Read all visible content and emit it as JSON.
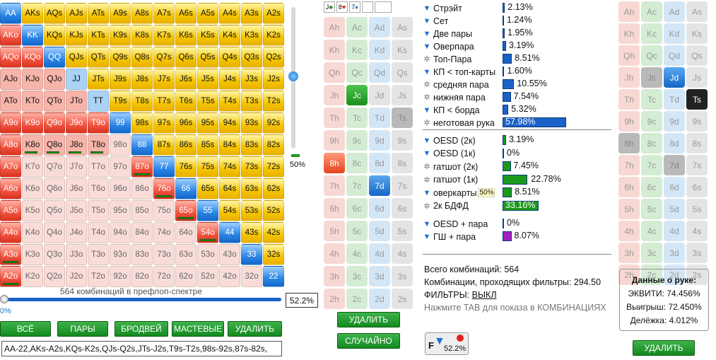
{
  "matrix": {
    "cells": [
      [
        "AA",
        "AKs",
        "AQs",
        "AJs",
        "ATs",
        "A9s",
        "A8s",
        "A7s",
        "A6s",
        "A5s",
        "A4s",
        "A3s",
        "A2s"
      ],
      [
        "AKo",
        "KK",
        "KQs",
        "KJs",
        "KTs",
        "K9s",
        "K8s",
        "K7s",
        "K6s",
        "K5s",
        "K4s",
        "K3s",
        "K2s"
      ],
      [
        "AQo",
        "KQo",
        "QQ",
        "QJs",
        "QTs",
        "Q9s",
        "Q8s",
        "Q7s",
        "Q6s",
        "Q5s",
        "Q4s",
        "Q3s",
        "Q2s"
      ],
      [
        "AJo",
        "KJo",
        "QJo",
        "JJ",
        "JTs",
        "J9s",
        "J8s",
        "J7s",
        "J6s",
        "J5s",
        "J4s",
        "J3s",
        "J2s"
      ],
      [
        "ATo",
        "KTo",
        "QTo",
        "JTo",
        "TT",
        "T9s",
        "T8s",
        "T7s",
        "T6s",
        "T5s",
        "T4s",
        "T3s",
        "T2s"
      ],
      [
        "A9o",
        "K9o",
        "Q9o",
        "J9o",
        "T9o",
        "99",
        "98s",
        "97s",
        "96s",
        "95s",
        "94s",
        "93s",
        "92s"
      ],
      [
        "A8o",
        "K8o",
        "Q8o",
        "J8o",
        "T8o",
        "98o",
        "88",
        "87s",
        "86s",
        "85s",
        "84s",
        "83s",
        "82s"
      ],
      [
        "A7o",
        "K7o",
        "Q7o",
        "J7o",
        "T7o",
        "97o",
        "87o",
        "77",
        "76s",
        "75s",
        "74s",
        "73s",
        "72s"
      ],
      [
        "A6o",
        "K6o",
        "Q6o",
        "J6o",
        "T6o",
        "96o",
        "86o",
        "76o",
        "66",
        "65s",
        "64s",
        "63s",
        "62s"
      ],
      [
        "A5o",
        "K5o",
        "Q5o",
        "J5o",
        "T5o",
        "95o",
        "85o",
        "75o",
        "65o",
        "55",
        "54s",
        "53s",
        "52s"
      ],
      [
        "A4o",
        "K4o",
        "Q4o",
        "J4o",
        "T4o",
        "94o",
        "84o",
        "74o",
        "64o",
        "54o",
        "44",
        "43s",
        "42s"
      ],
      [
        "A3o",
        "K3o",
        "Q3o",
        "J3o",
        "T3o",
        "93o",
        "83o",
        "73o",
        "63o",
        "53o",
        "43o",
        "33",
        "32s"
      ],
      [
        "A2o",
        "K2o",
        "Q2o",
        "J2o",
        "T2o",
        "92o",
        "82o",
        "72o",
        "62o",
        "52o",
        "42o",
        "32o",
        "22"
      ]
    ],
    "combo_label": "564 комбинаций в префлоп-спектре",
    "vertical_pct": "50%",
    "horizontal_pct": "52.2%",
    "horizontal_zero": "0%",
    "vertical_slider_level": 0.5,
    "horizontal_slider_level": 0.0
  },
  "matrix_buttons": [
    "ВСЁ",
    "ПАРЫ",
    "БРОДВЕЙ",
    "МАСТЕВЫЕ",
    "УДАЛИТЬ"
  ],
  "range_text": "AA-22,AKs-A2s,KQs-K2s,QJs-Q2s,JTs-J2s,T9s-T2s,98s-92s,87s-82s,",
  "board": {
    "slots": [
      {
        "rank": "J",
        "suit": "♣",
        "color": "#1a8f1a"
      },
      {
        "rank": "8",
        "suit": "♥",
        "color": "#d82020"
      },
      {
        "rank": "7",
        "suit": "♦",
        "color": "#1a76d2"
      },
      {
        "rank": "",
        "suit": "",
        "color": "#000"
      },
      {
        "rank": "",
        "suit": "",
        "color": "#000"
      }
    ],
    "rows": [
      [
        {
          "t": "Ah",
          "s": "h"
        },
        {
          "t": "Ac",
          "s": "c"
        },
        {
          "t": "Ad",
          "s": "d"
        },
        {
          "t": "As",
          "s": "s"
        }
      ],
      [
        {
          "t": "Kh",
          "s": "h"
        },
        {
          "t": "Kc",
          "s": "c"
        },
        {
          "t": "Kd",
          "s": "d"
        },
        {
          "t": "Ks",
          "s": "s"
        }
      ],
      [
        {
          "t": "Qh",
          "s": "h"
        },
        {
          "t": "Qc",
          "s": "c"
        },
        {
          "t": "Qd",
          "s": "d"
        },
        {
          "t": "Qs",
          "s": "s"
        }
      ],
      [
        {
          "t": "Jh",
          "s": "h"
        },
        {
          "t": "Jc",
          "s": "on-c"
        },
        {
          "t": "Jd",
          "s": "s"
        },
        {
          "t": "Js",
          "s": "s"
        }
      ],
      [
        {
          "t": "Th",
          "s": "h"
        },
        {
          "t": "Tc",
          "s": "c"
        },
        {
          "t": "Td",
          "s": "d"
        },
        {
          "t": "Ts",
          "s": "dis"
        }
      ],
      [
        {
          "t": "9h",
          "s": "h"
        },
        {
          "t": "9c",
          "s": "c"
        },
        {
          "t": "9d",
          "s": "d"
        },
        {
          "t": "9s",
          "s": "s"
        }
      ],
      [
        {
          "t": "8h",
          "s": "on-h"
        },
        {
          "t": "8c",
          "s": "c"
        },
        {
          "t": "8d",
          "s": "d"
        },
        {
          "t": "8s",
          "s": "s"
        }
      ],
      [
        {
          "t": "7h",
          "s": "h"
        },
        {
          "t": "7c",
          "s": "c"
        },
        {
          "t": "7d",
          "s": "on-d"
        },
        {
          "t": "7s",
          "s": "s"
        }
      ],
      [
        {
          "t": "6h",
          "s": "h"
        },
        {
          "t": "6c",
          "s": "c"
        },
        {
          "t": "6d",
          "s": "d"
        },
        {
          "t": "6s",
          "s": "s"
        }
      ],
      [
        {
          "t": "5h",
          "s": "h"
        },
        {
          "t": "5c",
          "s": "c"
        },
        {
          "t": "5d",
          "s": "d"
        },
        {
          "t": "5s",
          "s": "s"
        }
      ],
      [
        {
          "t": "4h",
          "s": "h"
        },
        {
          "t": "4c",
          "s": "c"
        },
        {
          "t": "4d",
          "s": "d"
        },
        {
          "t": "4s",
          "s": "s"
        }
      ],
      [
        {
          "t": "3h",
          "s": "h"
        },
        {
          "t": "3c",
          "s": "c"
        },
        {
          "t": "3d",
          "s": "d"
        },
        {
          "t": "3s",
          "s": "s"
        }
      ],
      [
        {
          "t": "2h",
          "s": "h"
        },
        {
          "t": "2c",
          "s": "c"
        },
        {
          "t": "2d",
          "s": "d"
        },
        {
          "t": "2s",
          "s": "s"
        }
      ]
    ],
    "delete": "УДАЛИТЬ",
    "random": "СЛУЧАЙНО"
  },
  "stats": [
    {
      "icon": "filter",
      "label": "Стрэйт",
      "pct": "2.13%",
      "value": 2.13,
      "color": "#1a62c8"
    },
    {
      "icon": "filter",
      "label": "Сет",
      "pct": "1.24%",
      "value": 1.24,
      "color": "#1a62c8"
    },
    {
      "icon": "filter",
      "label": "Две пары",
      "pct": "1.95%",
      "value": 1.95,
      "color": "#1a62c8"
    },
    {
      "icon": "filter",
      "label": "Оверпара",
      "pct": "3.19%",
      "value": 3.19,
      "color": "#1a62c8"
    },
    {
      "icon": "gear",
      "label": "Топ-Пара",
      "pct": "8.51%",
      "value": 8.51,
      "color": "#1a62c8"
    },
    {
      "icon": "filter",
      "label": "КП < топ-карты",
      "pct": "1.60%",
      "value": 1.6,
      "color": "#1a62c8"
    },
    {
      "icon": "gear",
      "label": "средняя пара",
      "pct": "10.55%",
      "value": 10.55,
      "color": "#1a62c8"
    },
    {
      "icon": "gear",
      "label": "нижняя пара",
      "pct": "7.54%",
      "value": 7.54,
      "color": "#1a62c8"
    },
    {
      "icon": "filter",
      "label": "КП < борда",
      "pct": "5.32%",
      "value": 5.32,
      "color": "#1a62c8"
    },
    {
      "icon": "gear",
      "label": "неготовая рука",
      "pct": "57.98%",
      "value": 57.98,
      "color": "#1a62c8"
    }
  ],
  "draws": [
    {
      "icon": "filter",
      "label": "OESD (2к)",
      "pct": "3.19%",
      "value": 3.19,
      "color": "#1a9a1a"
    },
    {
      "icon": "filter",
      "label": "OESD (1к)",
      "pct": "0%",
      "value": 0,
      "color": "#1a9a1a"
    },
    {
      "icon": "gear",
      "label": "гатшот (2к)",
      "pct": "7.45%",
      "value": 7.45,
      "color": "#1a9a1a"
    },
    {
      "icon": "gear",
      "label": "гатшот (1к)",
      "pct": "22.78%",
      "value": 22.78,
      "color": "#1a9a1a"
    },
    {
      "icon": "filter",
      "label": "оверкарты",
      "badge": "50%",
      "pct": "8.51%",
      "value": 8.51,
      "color": "#1a9a1a"
    },
    {
      "icon": "gear",
      "label": "2к БДФД",
      "pct": "33.16%",
      "value": 33.16,
      "color": "#1a9a1a"
    }
  ],
  "combos": [
    {
      "icon": "filter",
      "label": "OESD + пара",
      "pct": "0%",
      "value": 0,
      "color": "#a020c0"
    },
    {
      "icon": "filter",
      "label": "ГШ + пара",
      "pct": "8.07%",
      "value": 8.07,
      "color": "#a020c0"
    }
  ],
  "summary": {
    "total": "Всего комбинаций: 564",
    "passing": "Комбинации, проходящих фильтры: 294.50",
    "filters_label": "ФИЛЬТРЫ:",
    "filters_value": "ВЫКЛ",
    "hint": "Нажмите TAB для показа в КОМБИНАЦИЯХ",
    "f_badge": "52.2%"
  },
  "hand": {
    "rows": [
      [
        {
          "t": "Ah",
          "s": "h"
        },
        {
          "t": "Ac",
          "s": "c"
        },
        {
          "t": "Ad",
          "s": "d"
        },
        {
          "t": "As",
          "s": "s"
        }
      ],
      [
        {
          "t": "Kh",
          "s": "h"
        },
        {
          "t": "Kc",
          "s": "c"
        },
        {
          "t": "Kd",
          "s": "d"
        },
        {
          "t": "Ks",
          "s": "s"
        }
      ],
      [
        {
          "t": "Qh",
          "s": "h"
        },
        {
          "t": "Qc",
          "s": "c"
        },
        {
          "t": "Qd",
          "s": "d"
        },
        {
          "t": "Qs",
          "s": "s"
        }
      ],
      [
        {
          "t": "Jh",
          "s": "h"
        },
        {
          "t": "Jc",
          "s": "dis"
        },
        {
          "t": "Jd",
          "s": "on-d"
        },
        {
          "t": "Js",
          "s": "s"
        }
      ],
      [
        {
          "t": "Th",
          "s": "h"
        },
        {
          "t": "Tc",
          "s": "c"
        },
        {
          "t": "Td",
          "s": "d"
        },
        {
          "t": "Ts",
          "s": "on-s"
        }
      ],
      [
        {
          "t": "9h",
          "s": "h"
        },
        {
          "t": "9c",
          "s": "c"
        },
        {
          "t": "9d",
          "s": "d"
        },
        {
          "t": "9s",
          "s": "s"
        }
      ],
      [
        {
          "t": "8h",
          "s": "dis"
        },
        {
          "t": "8c",
          "s": "c"
        },
        {
          "t": "8d",
          "s": "d"
        },
        {
          "t": "8s",
          "s": "s"
        }
      ],
      [
        {
          "t": "7h",
          "s": "h"
        },
        {
          "t": "7c",
          "s": "c"
        },
        {
          "t": "7d",
          "s": "dis"
        },
        {
          "t": "7s",
          "s": "s"
        }
      ],
      [
        {
          "t": "6h",
          "s": "h"
        },
        {
          "t": "6c",
          "s": "c"
        },
        {
          "t": "6d",
          "s": "d"
        },
        {
          "t": "6s",
          "s": "s"
        }
      ],
      [
        {
          "t": "5h",
          "s": "h"
        },
        {
          "t": "5c",
          "s": "c"
        },
        {
          "t": "5d",
          "s": "d"
        },
        {
          "t": "5s",
          "s": "s"
        }
      ],
      [
        {
          "t": "4h",
          "s": "h"
        },
        {
          "t": "4c",
          "s": "c"
        },
        {
          "t": "4d",
          "s": "d"
        },
        {
          "t": "4s",
          "s": "s"
        }
      ],
      [
        {
          "t": "3h",
          "s": "h"
        },
        {
          "t": "3c",
          "s": "c"
        },
        {
          "t": "3d",
          "s": "d"
        },
        {
          "t": "3s",
          "s": "s"
        }
      ],
      [
        {
          "t": "2h",
          "s": "h"
        },
        {
          "t": "2c",
          "s": "c"
        },
        {
          "t": "2d",
          "s": "d"
        },
        {
          "t": "2s",
          "s": "s"
        }
      ]
    ],
    "info_title": "Данные о руке:",
    "equity": "ЭКВИТИ: 74.456%",
    "wins": "Выигрыш: 72.450%",
    "ties": "Делёжка: 4.012%",
    "delete": "УДАЛИТЬ"
  }
}
